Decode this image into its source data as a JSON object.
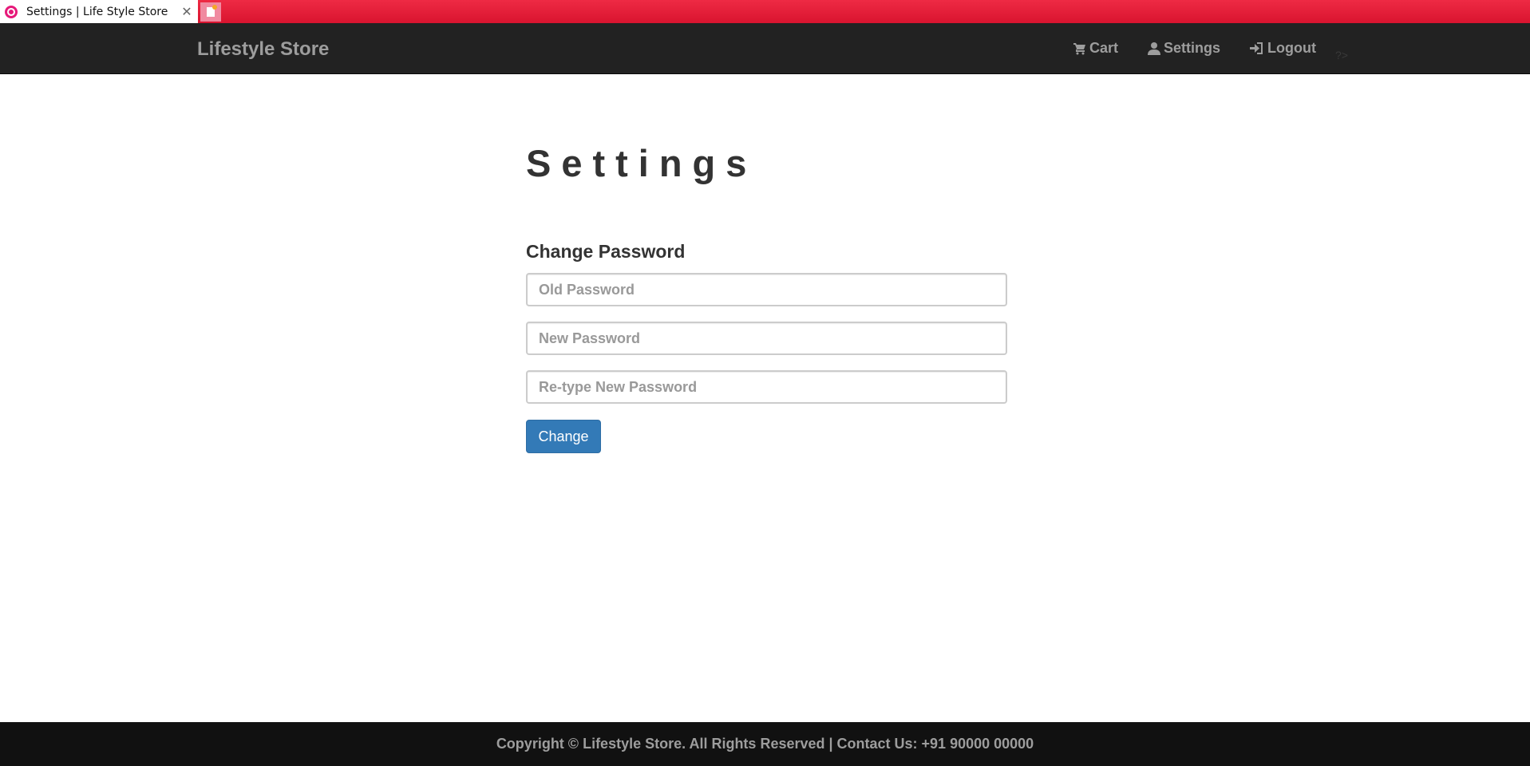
{
  "browser": {
    "tab_title": "Settings | Life Style Store",
    "tab_close": "✕"
  },
  "navbar": {
    "brand": "Lifestyle Store",
    "links": [
      {
        "label": "Cart",
        "icon": "cart-icon"
      },
      {
        "label": "Settings",
        "icon": "user-icon"
      },
      {
        "label": "Logout",
        "icon": "logout-icon"
      }
    ],
    "stray_text": "?>"
  },
  "main": {
    "title": "Settings",
    "section_title": "Change Password",
    "fields": {
      "old_password": {
        "placeholder": "Old Password",
        "value": ""
      },
      "new_password": {
        "placeholder": "New Password",
        "value": ""
      },
      "retype_password": {
        "placeholder": "Re-type New Password",
        "value": ""
      }
    },
    "submit_label": "Change"
  },
  "footer": {
    "text": "Copyright © Lifestyle Store. All Rights Reserved | Contact Us: +91 90000 00000"
  },
  "colors": {
    "tabstrip": "#e31b36",
    "navbar": "#222222",
    "footer": "#111111",
    "primary_button": "#337ab7",
    "nav_text": "#9d9d9d"
  }
}
